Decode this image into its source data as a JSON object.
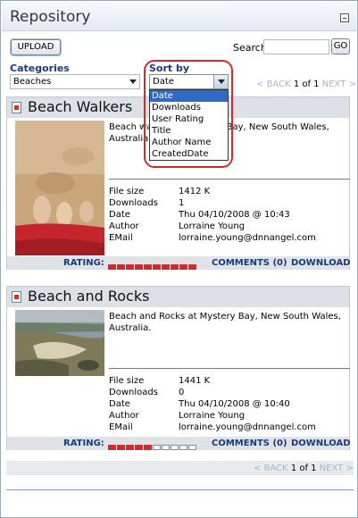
{
  "window": {
    "title": "Repository"
  },
  "toolbar": {
    "upload_label": "UPLOAD",
    "search_label": "Search",
    "search_value": "",
    "go_label": "GO"
  },
  "filters": {
    "categories_label": "Categories",
    "category_value": "Beaches",
    "sort_label": "Sort by",
    "sort_value": "Date",
    "sort_options": [
      "Date",
      "Downloads",
      "User Rating",
      "Title",
      "Author Name",
      "CreatedDate"
    ],
    "sort_selected_index": 0
  },
  "pager": {
    "back": "< BACK",
    "page_text": "1 of 1",
    "next": "NEXT >"
  },
  "items": [
    {
      "title": "Beach Walkers",
      "description": "Beach walkers at Mystery Bay, New South Wales, Australia.",
      "fields": [
        {
          "label": "File size",
          "value": "1412 K"
        },
        {
          "label": "Downloads",
          "value": "1"
        },
        {
          "label": "Date",
          "value": "Thu 04/10/2008 @ 10:43"
        },
        {
          "label": "Author",
          "value": "Lorraine Young"
        },
        {
          "label": "EMail",
          "value": "lorraine.young@dnnangel.com"
        }
      ],
      "rating_label": "RATING:",
      "rating": 10,
      "rating_max": 10,
      "comments_label": "COMMENTS (0)",
      "download_label": "DOWNLOAD"
    },
    {
      "title": "Beach and Rocks",
      "description": "Beach and Rocks at Mystery Bay, New South Wales, Australia.",
      "fields": [
        {
          "label": "File size",
          "value": "1441 K"
        },
        {
          "label": "Downloads",
          "value": "0"
        },
        {
          "label": "Date",
          "value": "Thu 04/10/2008 @ 10:40"
        },
        {
          "label": "Author",
          "value": "Lorraine Young"
        },
        {
          "label": "EMail",
          "value": "lorraine.young@dnnangel.com"
        }
      ],
      "rating_label": "RATING:",
      "rating": 5,
      "rating_max": 10,
      "comments_label": "COMMENTS (0)",
      "download_label": "DOWNLOAD"
    }
  ],
  "colors": {
    "accent": "#1b3b76",
    "rating_on": "#d8242c",
    "highlight_ring": "#d32b2b",
    "selected_option": "#3169c6"
  }
}
